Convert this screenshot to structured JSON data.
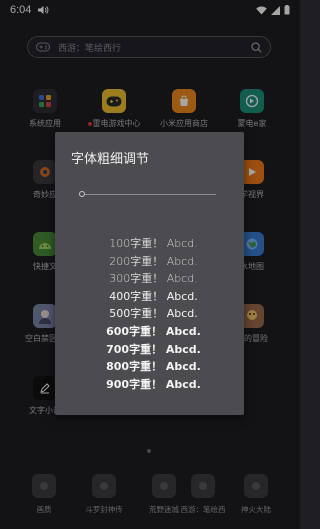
{
  "status_bar": {
    "time": "6:04"
  },
  "search": {
    "text": "西游：笔绘西行"
  },
  "apps": [
    {
      "label": "系统应用",
      "color": "#2e2d33"
    },
    {
      "label": "雷电游戏中心",
      "color": "#f2c230"
    },
    {
      "label": "小米应用商店",
      "color": "#f08a1c"
    },
    {
      "label": "蒙电e家",
      "color": "#1b8f7a"
    },
    {
      "label": "奇妙应",
      "color": "#3a3940"
    },
    {
      "label": "学视界",
      "color": "#f07a1a"
    },
    {
      "label": "快捷文",
      "color": "#4a8c3a"
    },
    {
      "label": "水地图",
      "color": "#3a7bd5"
    },
    {
      "label": "空白禁区武",
      "color": "#7a86a8"
    },
    {
      "label": "士的冒险",
      "color": "#9a6a4a"
    },
    {
      "label": "文字小说",
      "color": "#111111"
    }
  ],
  "dialog": {
    "title": "字体粗细调节",
    "slider_value": 0,
    "weights": [
      {
        "text": "100字重！ Abcd.",
        "weight": 100
      },
      {
        "text": "200字重！ Abcd.",
        "weight": 200
      },
      {
        "text": "300字重！ Abcd.",
        "weight": 300
      },
      {
        "text": "400字重！ Abcd.",
        "weight": 400
      },
      {
        "text": "500字重！ Abcd.",
        "weight": 500
      },
      {
        "text": "600字重！ Abcd.",
        "weight": 600
      },
      {
        "text": "700字重！ Abcd.",
        "weight": 700
      },
      {
        "text": "800字重！ Abcd.",
        "weight": 800
      },
      {
        "text": "900字重！ Abcd.",
        "weight": 900
      }
    ]
  },
  "dock": [
    {
      "label": "画质"
    },
    {
      "label": "斗罗封神传"
    },
    {
      "label": "荒野迷城"
    },
    {
      "label": "西游：笔绘西"
    },
    {
      "label": "神火大陆"
    }
  ]
}
